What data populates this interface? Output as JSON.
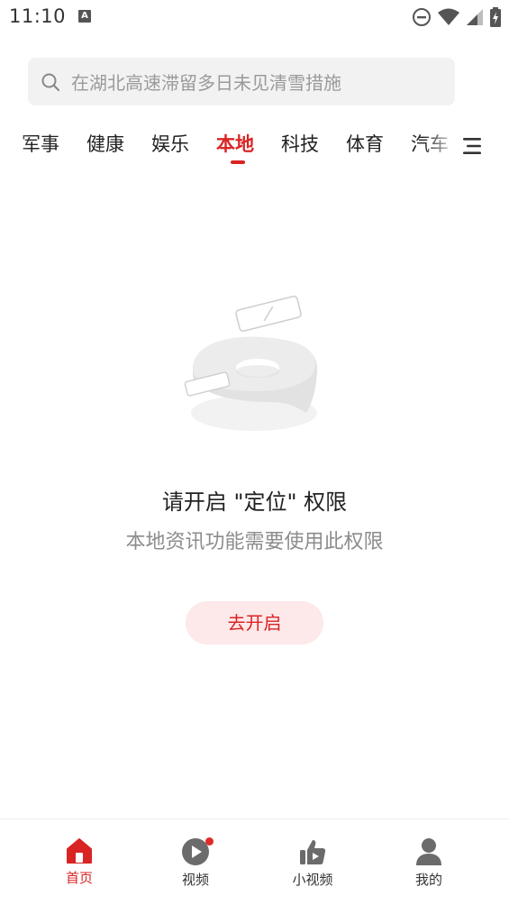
{
  "status_bar": {
    "time": "11:10",
    "notification_letter": "A",
    "icons": [
      "dnd-icon",
      "wifi-icon",
      "signal-icon",
      "battery-charging-icon"
    ]
  },
  "search": {
    "placeholder": "在湖北高速滞留多日未见清雪措施",
    "icon": "search-icon"
  },
  "tabs": [
    {
      "label": "军事",
      "active": false
    },
    {
      "label": "健康",
      "active": false
    },
    {
      "label": "娱乐",
      "active": false
    },
    {
      "label": "本地",
      "active": true
    },
    {
      "label": "科技",
      "active": false
    },
    {
      "label": "体育",
      "active": false
    },
    {
      "label": "汽车",
      "active": false
    }
  ],
  "tab_menu_icon": "menu-icon",
  "empty_state": {
    "illustration": "location-pin-illustration",
    "title": "请开启 \"定位\" 权限",
    "subtitle": "本地资讯功能需要使用此权限",
    "button_label": "去开启"
  },
  "bottom_nav": [
    {
      "label": "首页",
      "icon": "home-icon",
      "active": true
    },
    {
      "label": "视频",
      "icon": "play-icon",
      "active": false,
      "badge": true
    },
    {
      "label": "小视频",
      "icon": "thumbs-up-video-icon",
      "active": false
    },
    {
      "label": "我的",
      "icon": "person-icon",
      "active": false
    }
  ],
  "colors": {
    "accent": "#d92424",
    "button_bg": "#fde8ea",
    "search_bg": "#f2f2f2",
    "muted_text": "#8c8c8c"
  }
}
